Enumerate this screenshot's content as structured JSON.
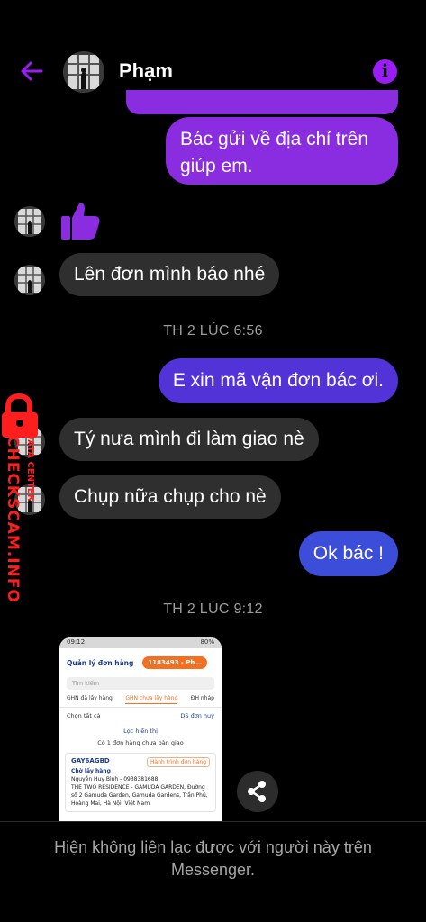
{
  "header": {
    "name": "Phạm",
    "back_icon": "arrow-left-icon",
    "info_icon": "info-icon",
    "info_glyph": "i"
  },
  "messages": {
    "m1": "Bác gửi về địa chỉ trên giúp em.",
    "m3": "Lên đơn mình báo nhé",
    "m4": "E xin mã vận đơn bác ơi.",
    "m5": "Tý nưa mình đi làm giao nè",
    "m6": "Chụp nữa chụp cho nè",
    "m7": "Ok bác !"
  },
  "timestamps": {
    "t1": "TH 2 LÚC 6:56",
    "t2": "TH 2 LÚC 9:12"
  },
  "watermark": {
    "text": "CHECKSCAM.INFO",
    "sub": "DATA CENTER"
  },
  "screenshot": {
    "status_time": "09:12",
    "status_right": "80%",
    "title": "Quản lý đơn hàng",
    "account": "1183493 - Ph...",
    "search_placeholder": "Tìm kiếm",
    "tab1": "GHN đã lấy hàng",
    "tab2": "GHN chưa lấy hàng",
    "tab3": "ĐH nháp",
    "select_all": "Chọn tất cả",
    "cancelled": "DS đơn huỷ",
    "filter": "Lọc hiển thị",
    "notice": "Có 1 đơn hàng chưa bàn giao",
    "order_code": "GAY6AGBD",
    "journey": "Hành trình đơn hàng",
    "status": "Chờ lấy hàng",
    "customer": "Nguyễn Huy Bình - 0938381688",
    "address": "THE TWO RESIDENCE - GAMUDA GARDEN, Đường số 2 Gamuda Garden, Gamuda Gardens, Trần Phú, Hoàng Mai, Hà Nội, Việt Nam"
  },
  "footer": {
    "text": "Hiện không liên lạc được với người này trên Messenger."
  },
  "colors": {
    "purple": "#8a2ce0",
    "violet": "#5233d8",
    "indigo": "#3c4dd9",
    "incoming": "#2f2f2f",
    "accent": "#9b1df5"
  },
  "icons": [
    "thumbs-up-icon",
    "share-icon",
    "lock-icon"
  ]
}
